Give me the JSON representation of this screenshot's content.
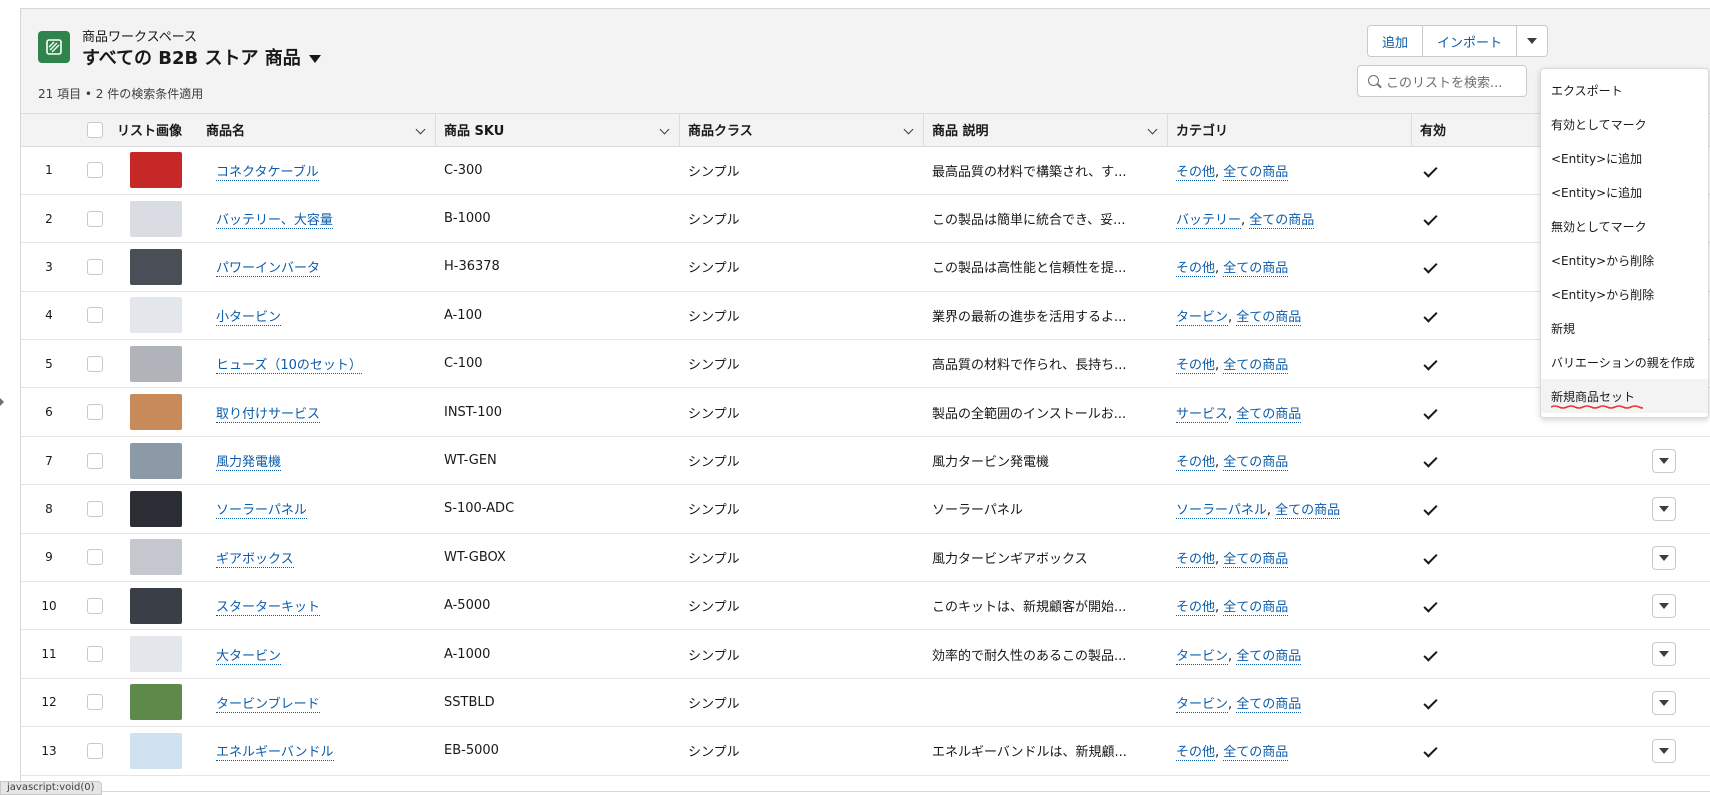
{
  "header": {
    "subtitle": "商品ワークスペース",
    "title": "すべての B2B ストア 商品",
    "meta": "21 項目 • 2 件の検索条件適用",
    "icon": "product-workspace-icon"
  },
  "toolbar": {
    "add_label": "追加",
    "import_label": "インポート",
    "search_placeholder": "このリストを検索..."
  },
  "columns": {
    "image": "リスト画像",
    "name": "商品名",
    "sku": "商品 SKU",
    "class": "商品クラス",
    "description": "商品 説明",
    "category": "カテゴリ",
    "active": "有効"
  },
  "rows": [
    {
      "num": "1",
      "name": "コネクタケーブル",
      "sku": "C-300",
      "class": "シンプル",
      "description": "最高品質の材料で構築され、す...",
      "cat1": "その他",
      "cat2": "全ての商品",
      "thumb_color": "#c62828"
    },
    {
      "num": "2",
      "name": "バッテリー、大容量",
      "sku": "B-1000",
      "class": "シンプル",
      "description": "この製品は簡単に統合でき、妥...",
      "cat1": "バッテリー",
      "cat2": "全ての商品",
      "thumb_color": "#d9dde3"
    },
    {
      "num": "3",
      "name": "パワーインバータ",
      "sku": "H-36378",
      "class": "シンプル",
      "description": "この製品は高性能と信頼性を提...",
      "cat1": "その他",
      "cat2": "全ての商品",
      "thumb_color": "#4a4f57"
    },
    {
      "num": "4",
      "name": "小タービン",
      "sku": "A-100",
      "class": "シンプル",
      "description": "業界の最新の進歩を活用するよ...",
      "cat1": "タービン",
      "cat2": "全ての商品",
      "thumb_color": "#e3e6ea"
    },
    {
      "num": "5",
      "name": "ヒューズ（10のセット）",
      "sku": "C-100",
      "class": "シンプル",
      "description": "高品質の材料で作られ、長持ち...",
      "cat1": "その他",
      "cat2": "全ての商品",
      "thumb_color": "#b0b4ba"
    },
    {
      "num": "6",
      "name": "取り付けサービス",
      "sku": "INST-100",
      "class": "シンプル",
      "description": "製品の全範囲のインストールお...",
      "cat1": "サービス",
      "cat2": "全ての商品",
      "thumb_color": "#c98a5a"
    },
    {
      "num": "7",
      "name": "風力発電機",
      "sku": "WT-GEN",
      "class": "シンプル",
      "description": "風力タービン発電機",
      "cat1": "その他",
      "cat2": "全ての商品",
      "thumb_color": "#8c9aa8"
    },
    {
      "num": "8",
      "name": "ソーラーパネル",
      "sku": "S-100-ADC",
      "class": "シンプル",
      "description": "ソーラーパネル",
      "cat1": "ソーラーパネル",
      "cat2": "全ての商品",
      "thumb_color": "#2a2d33"
    },
    {
      "num": "9",
      "name": "ギアボックス",
      "sku": "WT-GBOX",
      "class": "シンプル",
      "description": "風力タービンギアボックス",
      "cat1": "その他",
      "cat2": "全ての商品",
      "thumb_color": "#c4c8ce"
    },
    {
      "num": "10",
      "name": "スターターキット",
      "sku": "A-5000",
      "class": "シンプル",
      "description": "このキットは、新規顧客が開始...",
      "cat1": "その他",
      "cat2": "全ての商品",
      "thumb_color": "#3a3f47"
    },
    {
      "num": "11",
      "name": "大タービン",
      "sku": "A-1000",
      "class": "シンプル",
      "description": "効率的で耐久性のあるこの製品...",
      "cat1": "タービン",
      "cat2": "全ての商品",
      "thumb_color": "#e3e6ea"
    },
    {
      "num": "12",
      "name": "タービンブレード",
      "sku": "SSTBLD",
      "class": "シンプル",
      "description": "",
      "cat1": "タービン",
      "cat2": "全ての商品",
      "thumb_color": "#5d8a4a"
    },
    {
      "num": "13",
      "name": "エネルギーバンドル",
      "sku": "EB-5000",
      "class": "シンプル",
      "description": "エネルギーバンドルは、新規顧...",
      "cat1": "その他",
      "cat2": "全ての商品",
      "thumb_color": "#cfe0ef"
    }
  ],
  "menu": [
    "エクスポート",
    "有効としてマーク",
    "<Entity>に追加",
    "<Entity>に追加",
    "無効としてマーク",
    "<Entity>から削除",
    "<Entity>から削除",
    "新規",
    "バリエーションの親を作成",
    "新規商品セット"
  ],
  "status_bar": "javascript:void(0)",
  "colors": {
    "link": "#0b5cab",
    "icon_bg": "#2e844a",
    "annotation": "#e53935"
  }
}
